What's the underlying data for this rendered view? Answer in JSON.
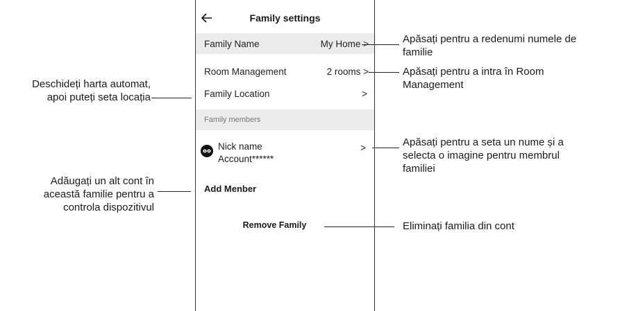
{
  "header": {
    "title": "Family settings"
  },
  "rows": {
    "family_name": {
      "label": "Family Name",
      "value": "My Home >"
    },
    "room_management": {
      "label": "Room Management",
      "value": "2 rooms >"
    },
    "family_location": {
      "label": "Family Location",
      "value": ">"
    }
  },
  "members_section": {
    "title": "Family members"
  },
  "member": {
    "name": "Nick name",
    "account": "Account******",
    "chevron": ">"
  },
  "add_member": {
    "label": "Add Menber"
  },
  "remove_family": {
    "label": "Remove Family"
  },
  "annotations": {
    "rename": [
      "Apăsați pentru a redenumi numele de",
      "familie"
    ],
    "room_mgmt": [
      "Apăsați pentru a intra în Room",
      "Management"
    ],
    "member": [
      "Apăsați pentru a seta un nume și a",
      "selecta o imagine pentru membrul",
      "familiei"
    ],
    "remove": [
      "Eliminați familia din cont"
    ],
    "location": [
      "Deschideți harta automat,",
      "apoi puteți seta locația"
    ],
    "add": [
      "Adăugați un alt cont în",
      "această familie pentru a",
      "controla dispozitivul"
    ]
  }
}
